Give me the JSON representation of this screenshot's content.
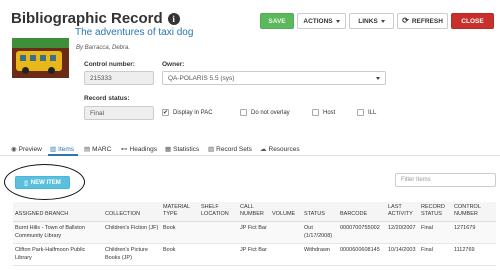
{
  "header": {
    "title": "Bibliographic Record",
    "info_glyph": "i"
  },
  "toolbar": {
    "save_label": "SAVE",
    "actions_label": "ACTIONS",
    "links_label": "LINKS",
    "refresh_label": "REFRESH",
    "close_label": "CLOSE"
  },
  "record": {
    "title": "The adventures of taxi dog",
    "author": "By Barracca, Debra.",
    "control_number_label": "Control number:",
    "control_number": "215333",
    "owner_label": "Owner:",
    "owner": "QA-POLARIS 5.5 (sys)",
    "status_label": "Record status:",
    "status": "Final"
  },
  "options": {
    "display_in_pac": {
      "label": "Display in PAC",
      "checked": true
    },
    "do_not_overlay": {
      "label": "Do not overlay",
      "checked": false
    },
    "host": {
      "label": "Host",
      "checked": false
    },
    "ill": {
      "label": "ILL",
      "checked": false
    }
  },
  "tabs": [
    {
      "label": "Preview",
      "icon": "eye-icon",
      "glyph": "◉"
    },
    {
      "label": "Items",
      "icon": "items-icon",
      "glyph": "▥",
      "active": true
    },
    {
      "label": "MARC",
      "icon": "marc-icon",
      "glyph": "▤"
    },
    {
      "label": "Headings",
      "icon": "headings-icon",
      "glyph": "⊷"
    },
    {
      "label": "Statistics",
      "icon": "statistics-icon",
      "glyph": "▦"
    },
    {
      "label": "Record Sets",
      "icon": "record-sets-icon",
      "glyph": "▧"
    },
    {
      "label": "Resources",
      "icon": "cloud-icon",
      "glyph": "☁"
    }
  ],
  "items_panel": {
    "new_item_label": "NEW ITEM",
    "filter_placeholder": "Filter Items",
    "columns": [
      "ASSIGNED BRANCH",
      "COLLECTION",
      "MATERIAL TYPE",
      "SHELF LOCATION",
      "CALL NUMBER",
      "VOLUME",
      "STATUS",
      "BARCODE",
      "LAST ACTIVITY",
      "RECORD STATUS",
      "CONTROL NUMBER"
    ],
    "rows": [
      [
        "Burnt Hills - Town of Ballston Community Library",
        "Children's Fiction (JF)",
        "Book",
        "",
        "JP Fict Bar",
        "",
        "Out (1/17/2008)",
        "0000700755002",
        "12/20/2007",
        "Final",
        "1271679"
      ],
      [
        "Clifton Park-Halfmoon Public Library",
        "Children's Picture Books (JP)",
        "Book",
        "",
        "JP Fict Bar",
        "",
        "Withdrawn",
        "0000600608145",
        "10/14/2003",
        "Final",
        "1112769"
      ]
    ]
  }
}
